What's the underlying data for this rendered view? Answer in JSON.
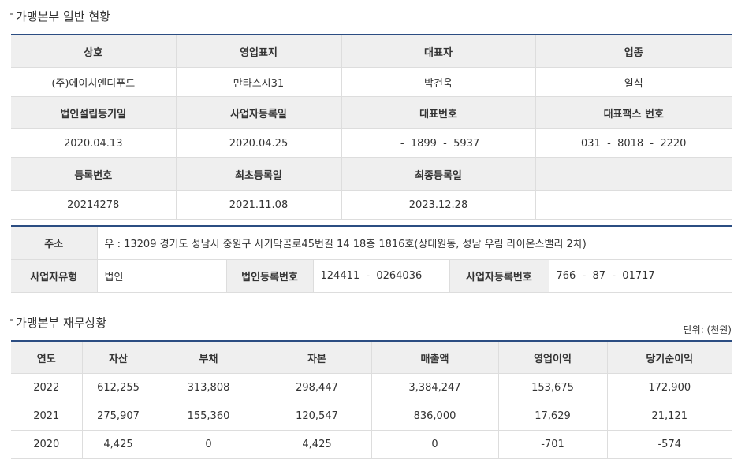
{
  "general": {
    "title": "가맹본부 일반 현황",
    "headers1": [
      "상호",
      "영업표지",
      "대표자",
      "업종"
    ],
    "values1": [
      "(주)에이치엔디푸드",
      "만타스시31",
      "박건욱",
      "일식"
    ],
    "headers2": [
      "법인설립등기일",
      "사업자등록일",
      "대표번호",
      "대표팩스 번호"
    ],
    "values2": [
      "2020.04.13",
      "2020.04.25",
      " -  1899  -  5937",
      "031  -  8018  -  2220"
    ],
    "headers3": [
      "등록번호",
      "최초등록일",
      "최종등록일",
      ""
    ],
    "values3": [
      "20214278",
      "2021.11.08",
      "2023.12.28",
      ""
    ]
  },
  "address": {
    "label": "주소",
    "value": "우 : 13209 경기도 성남시 중원구 사기막골로45번길 14 18층 1816호(상대원동, 성남 우림 라이온스밸리 2차)",
    "biz_type_label": "사업자유형",
    "biz_type_value": "법인",
    "corp_no_label": "법인등록번호",
    "corp_no_value": "124411  -  0264036",
    "biz_no_label": "사업자등록번호",
    "biz_no_value": "766  -  87  -  01717"
  },
  "finance": {
    "title": "가맹본부 재무상황",
    "unit": "단위: (천원)",
    "headers": [
      "연도",
      "자산",
      "부채",
      "자본",
      "매출액",
      "영업이익",
      "당기순이익"
    ],
    "rows": [
      [
        "2022",
        "612,255",
        "313,808",
        "298,447",
        "3,384,247",
        "153,675",
        "172,900"
      ],
      [
        "2021",
        "275,907",
        "155,360",
        "120,547",
        "836,000",
        "17,629",
        "21,121"
      ],
      [
        "2020",
        "4,425",
        "0",
        "4,425",
        "0",
        "-701",
        "-574"
      ]
    ]
  }
}
